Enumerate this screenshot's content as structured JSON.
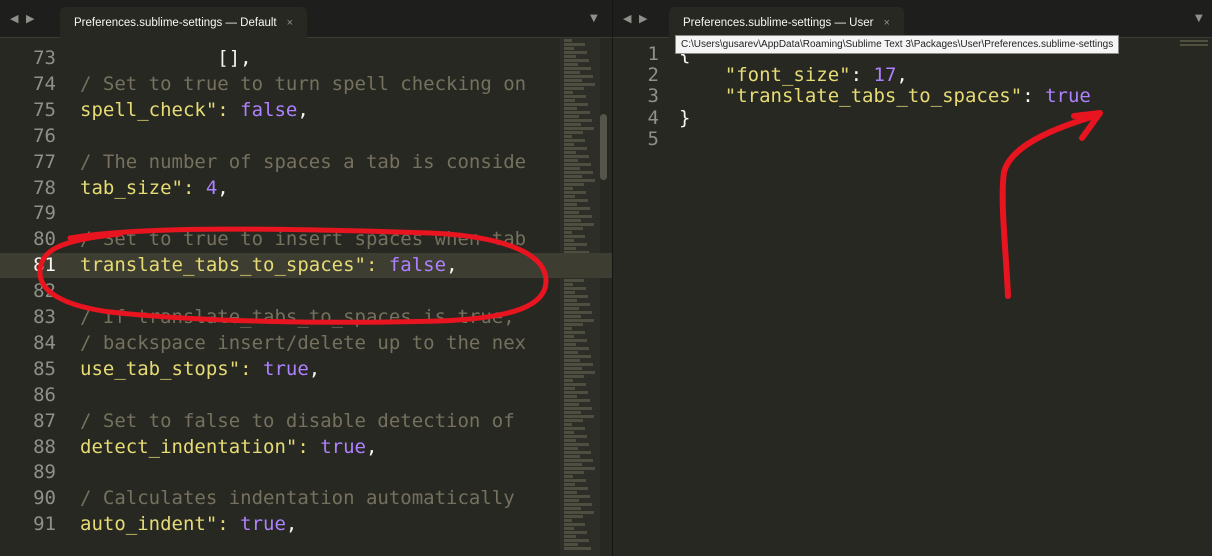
{
  "left_tab": {
    "title": "Preferences.sublime-settings — Default",
    "close": "×"
  },
  "right_tab": {
    "title": "Preferences.sublime-settings — User",
    "close": "×"
  },
  "nav_arrows": "◀ ▶",
  "dropdown_glyph": "▼",
  "tooltip": "C:\\Users\\gusarev\\AppData\\Roaming\\Sublime Text 3\\Packages\\User\\Preferences.sublime-settings",
  "left_lines": [
    {
      "num": "73",
      "parts": [
        {
          "t": "            [],",
          "k": "p"
        }
      ]
    },
    {
      "num": "74",
      "parts": [
        {
          "t": "/ Set to true to turn spell checking on",
          "k": "c"
        }
      ]
    },
    {
      "num": "75",
      "parts": [
        {
          "t": "spell_check\": ",
          "k": "s"
        },
        {
          "t": "false",
          "k": "b"
        },
        {
          "t": ",",
          "k": "p"
        }
      ]
    },
    {
      "num": "76",
      "parts": []
    },
    {
      "num": "77",
      "parts": [
        {
          "t": "/ The number of spaces a tab is conside",
          "k": "c"
        }
      ]
    },
    {
      "num": "78",
      "parts": [
        {
          "t": "tab_size\": ",
          "k": "s"
        },
        {
          "t": "4",
          "k": "n"
        },
        {
          "t": ",",
          "k": "p"
        }
      ]
    },
    {
      "num": "79",
      "parts": []
    },
    {
      "num": "80",
      "parts": [
        {
          "t": "/ Set to true to insert spaces when tab",
          "k": "c"
        }
      ]
    },
    {
      "num": "81",
      "parts": [
        {
          "t": "translate_tabs_to_spaces\": ",
          "k": "s"
        },
        {
          "t": "false",
          "k": "b"
        },
        {
          "t": ",",
          "k": "p"
        }
      ]
    },
    {
      "num": "82",
      "parts": []
    },
    {
      "num": "83",
      "parts": [
        {
          "t": "/ If translate_tabs_to_spaces is true,",
          "k": "c"
        }
      ]
    },
    {
      "num": "84",
      "parts": [
        {
          "t": "/ backspace insert/delete up to the nex",
          "k": "c"
        }
      ]
    },
    {
      "num": "85",
      "parts": [
        {
          "t": "use_tab_stops\": ",
          "k": "s"
        },
        {
          "t": "true",
          "k": "b"
        },
        {
          "t": ",",
          "k": "p"
        }
      ]
    },
    {
      "num": "86",
      "parts": []
    },
    {
      "num": "87",
      "parts": [
        {
          "t": "/ Set to false to disable detection of",
          "k": "c"
        }
      ]
    },
    {
      "num": "88",
      "parts": [
        {
          "t": "detect_indentation\": ",
          "k": "s"
        },
        {
          "t": "true",
          "k": "b"
        },
        {
          "t": ",",
          "k": "p"
        }
      ]
    },
    {
      "num": "89",
      "parts": []
    },
    {
      "num": "90",
      "parts": [
        {
          "t": "/ Calculates indentation automatically",
          "k": "c"
        }
      ]
    },
    {
      "num": "91",
      "parts": [
        {
          "t": "auto_indent\": ",
          "k": "s"
        },
        {
          "t": "true",
          "k": "b"
        },
        {
          "t": ",",
          "k": "p"
        }
      ]
    }
  ],
  "right_lines": [
    {
      "num": "1",
      "parts": [
        {
          "t": "{",
          "k": "p"
        }
      ]
    },
    {
      "num": "2",
      "parts": [
        {
          "t": "    ",
          "k": "p"
        },
        {
          "t": "\"font_size\"",
          "k": "s"
        },
        {
          "t": ": ",
          "k": "p"
        },
        {
          "t": "17",
          "k": "n"
        },
        {
          "t": ",",
          "k": "p"
        }
      ]
    },
    {
      "num": "3",
      "parts": [
        {
          "t": "    ",
          "k": "p"
        },
        {
          "t": "\"translate_tabs_to_spaces\"",
          "k": "s"
        },
        {
          "t": ": ",
          "k": "p"
        },
        {
          "t": "true",
          "k": "b"
        }
      ]
    },
    {
      "num": "4",
      "parts": [
        {
          "t": "}",
          "k": "p"
        }
      ]
    },
    {
      "num": "5",
      "parts": []
    }
  ],
  "highlighted_line": "81",
  "colors": {
    "background": "#272822",
    "comment": "#75715e",
    "string": "#e6db74",
    "constant": "#ae81ff",
    "annotation": "#e8141f"
  }
}
